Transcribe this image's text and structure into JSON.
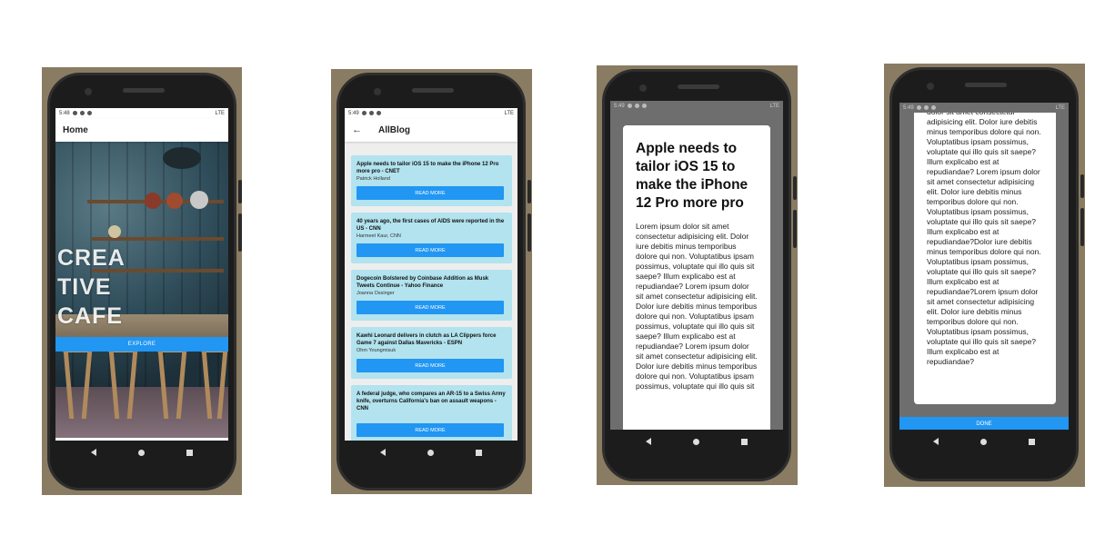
{
  "status": {
    "time_a": "5:48",
    "time_b": "5:49",
    "network": "LTE"
  },
  "screen_home": {
    "title": "Home",
    "hero_text": "CREA TIVE CAFE",
    "explore_label": "EXPLORE"
  },
  "screen_allblog": {
    "back_label": "←",
    "title": "AllBlog",
    "cards": [
      {
        "title": "Apple needs to tailor iOS 15 to make the iPhone 12 Pro more pro - CNET",
        "author": "Patrick Holland",
        "button": "READ MORE"
      },
      {
        "title": "40 years ago, the first cases of AIDS were reported in the US - CNN",
        "author": "Harmeet Kaur, CNN",
        "button": "READ MORE"
      },
      {
        "title": "Dogecoin Bolstered by Coinbase Addition as Musk Tweets Continue - Yahoo Finance",
        "author": "Joanna Ossinger",
        "button": "READ MORE"
      },
      {
        "title": "Kawhi Leonard delivers in clutch as LA Clippers force Game 7 against Dallas Mavericks - ESPN",
        "author": "Ohm Youngmisuk",
        "button": "READ MORE"
      },
      {
        "title": "A federal judge, who compares an AR-15 to a Swiss Army knife, overturns California's ban on assault weapons - CNN",
        "author": "",
        "button": "READ MORE"
      }
    ]
  },
  "screen_detail": {
    "title": "Apple needs to tailor iOS 15 to make the iPhone 12 Pro more pro",
    "body": "Lorem ipsum dolor sit amet consectetur adipisicing elit. Dolor iure debitis minus temporibus dolore qui non. Voluptatibus ipsam possimus, voluptate qui illo quis sit saepe? Illum explicabo est at repudiandae? Lorem ipsum dolor sit amet consectetur adipisicing elit. Dolor iure debitis minus temporibus dolore qui non. Voluptatibus ipsam possimus, voluptate qui illo quis sit saepe? Illum explicabo est at repudiandae? Lorem ipsum dolor sit amet consectetur adipisicing elit. Dolor iure debitis minus temporibus dolore qui non. Voluptatibus ipsam possimus, voluptate qui illo quis sit"
  },
  "screen_detail_scrolled": {
    "body_top": "dolor sit amet consectetur adipisicing elit. Dolor iure debitis minus temporibus dolore qui non. Voluptatibus ipsam possimus, voluptate qui illo quis sit saepe? Illum explicabo est at repudiandae? Lorem ipsum dolor sit amet consectetur adipisicing elit. Dolor iure debitis minus temporibus dolore qui non. Voluptatibus ipsam possimus, voluptate qui illo quis sit saepe? Illum explicabo est at repudiandae?Dolor iure debitis minus temporibus dolore qui non. Voluptatibus ipsam possimus, voluptate qui illo quis sit saepe? Illum explicabo est at repudiandae?Lorem ipsum dolor sit amet consectetur adipisicing elit. Dolor iure debitis minus temporibus dolore qui non. Voluptatibus ipsam possimus, voluptate qui illo quis sit saepe? Illum explicabo est at repudiandae?",
    "done_label": "DONE"
  },
  "colors": {
    "accent": "#2196f3",
    "card_bg": "#b2e3ee",
    "frame_bg": "#8a7c62"
  }
}
